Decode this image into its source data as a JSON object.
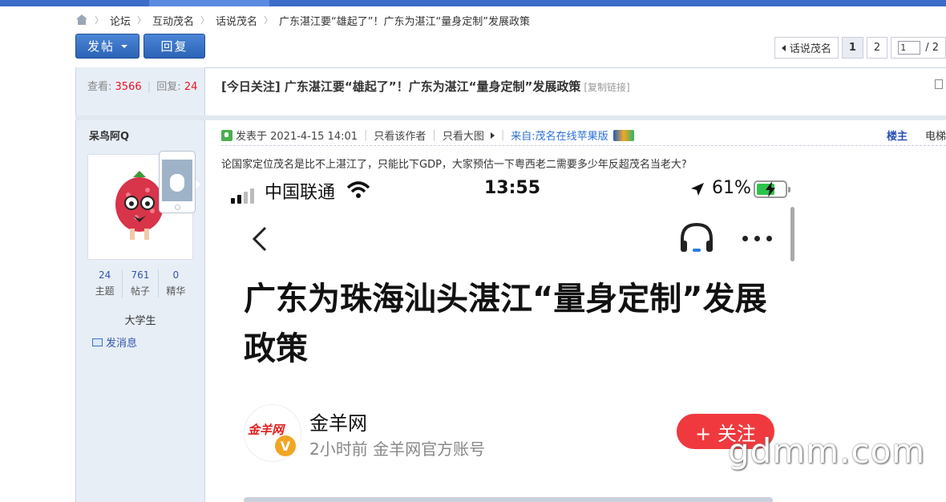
{
  "breadcrumb": {
    "items": [
      "论坛",
      "互动茂名",
      "话说茂名",
      "广东湛江要“雄起了”！广东为湛江“量身定制”发展政策"
    ]
  },
  "toolbar": {
    "post_label": "发帖",
    "reply_label": "回复"
  },
  "pager": {
    "back_label": "话说茂名",
    "pages": [
      "1",
      "2"
    ],
    "current_page": "1",
    "input_value": "1",
    "total": "/ 2"
  },
  "thread": {
    "views_label": "查看:",
    "views": "3566",
    "replies_label": "回复:",
    "replies": "24",
    "title": "[今日关注] 广东湛江要“雄起了”！广东为湛江“量身定制”发展政策",
    "copy_link": "[复制链接]"
  },
  "author": {
    "name": "呆鸟阿Q",
    "stats": [
      {
        "value": "24",
        "label": "主题"
      },
      {
        "value": "761",
        "label": "帖子"
      },
      {
        "value": "0",
        "label": "精华"
      }
    ],
    "rank": "大学生",
    "pm_label": "发消息"
  },
  "post": {
    "published": "发表于 2021-4-15 14:01",
    "only_author": "只看该作者",
    "big_image": "只看大图",
    "source": "来自:茂名在线苹果版",
    "floor": "楼主",
    "elevator": "电梯",
    "body": "论国家定位茂名是比不上湛江了，只能比下GDP，大家预估一下粤西老二需要多少年反超茂名当老大?"
  },
  "screenshot": {
    "carrier": "中国联通",
    "time": "13:55",
    "battery": "61%",
    "headline": "广东为珠海汕头湛江“量身定制”发展政策",
    "publisher": "金羊网",
    "publisher_logo_text": "金羊网",
    "publisher_meta": "2小时前 金羊网官方账号",
    "follow_label": "+ 关注"
  },
  "watermark": "gdmm.com",
  "colors": {
    "accent": "#2b63b6",
    "count_red": "#e12",
    "follow_red": "#f0393e",
    "battery_green": "#2cc34a"
  }
}
